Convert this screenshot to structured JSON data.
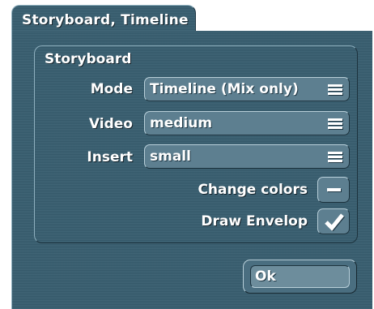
{
  "window": {
    "tab_title": "Storyboard, Timeline"
  },
  "group": {
    "title": "Storyboard",
    "rows": [
      {
        "label": "Mode",
        "value": "Timeline (Mix only)",
        "icon": "menu-icon"
      },
      {
        "label": "Video",
        "value": "medium",
        "icon": "menu-icon"
      },
      {
        "label": "Insert",
        "value": "small",
        "icon": "menu-icon"
      }
    ],
    "toggles": [
      {
        "label": "Change colors",
        "state": "off",
        "icon": "dash-icon"
      },
      {
        "label": "Draw Envelop",
        "state": "on",
        "icon": "checkmark-icon"
      }
    ]
  },
  "buttons": {
    "ok": "Ok"
  },
  "colors": {
    "panel": "#385e70",
    "field": "#5d7f90",
    "text": "#ffffff"
  }
}
